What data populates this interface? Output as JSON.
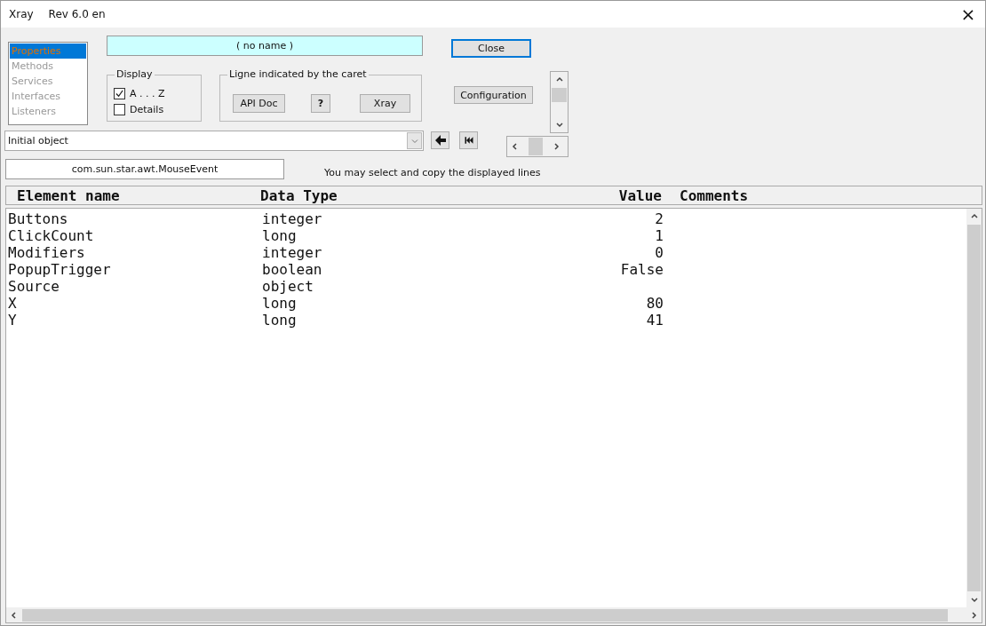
{
  "window": {
    "title": "Xray",
    "subtitle": "Rev 6.0 en",
    "close": "×"
  },
  "views": [
    {
      "label": "Properties",
      "selected": true
    },
    {
      "label": "Methods",
      "selected": false
    },
    {
      "label": "Services",
      "selected": false
    },
    {
      "label": "Interfaces",
      "selected": false
    },
    {
      "label": "Listeners",
      "selected": false
    }
  ],
  "object_name": "( no name )",
  "display": {
    "title": "Display",
    "options": [
      {
        "label": "A . . . Z",
        "checked": true
      },
      {
        "label": "Details",
        "checked": false
      }
    ]
  },
  "caret_group": {
    "title": "Ligne indicated by the caret",
    "buttons": [
      "API Doc",
      "?",
      "Xray"
    ]
  },
  "close_button": "Close",
  "configuration_button": "Configuration",
  "object_select": {
    "value": "Initial object"
  },
  "type_name": "com.sun.star.awt.MouseEvent",
  "hint": "You may select and copy the displayed lines",
  "table": {
    "columns": [
      "Element name",
      "Data Type",
      "Value",
      "Comments"
    ],
    "rows": [
      [
        "Buttons",
        "integer",
        "2"
      ],
      [
        "ClickCount",
        "long",
        "1"
      ],
      [
        "Modifiers",
        "integer",
        "0"
      ],
      [
        "PopupTrigger",
        "boolean",
        "False"
      ],
      [
        "Source",
        "object",
        ""
      ],
      [
        "X",
        "long",
        "80"
      ],
      [
        "Y",
        "long",
        "41"
      ]
    ]
  }
}
